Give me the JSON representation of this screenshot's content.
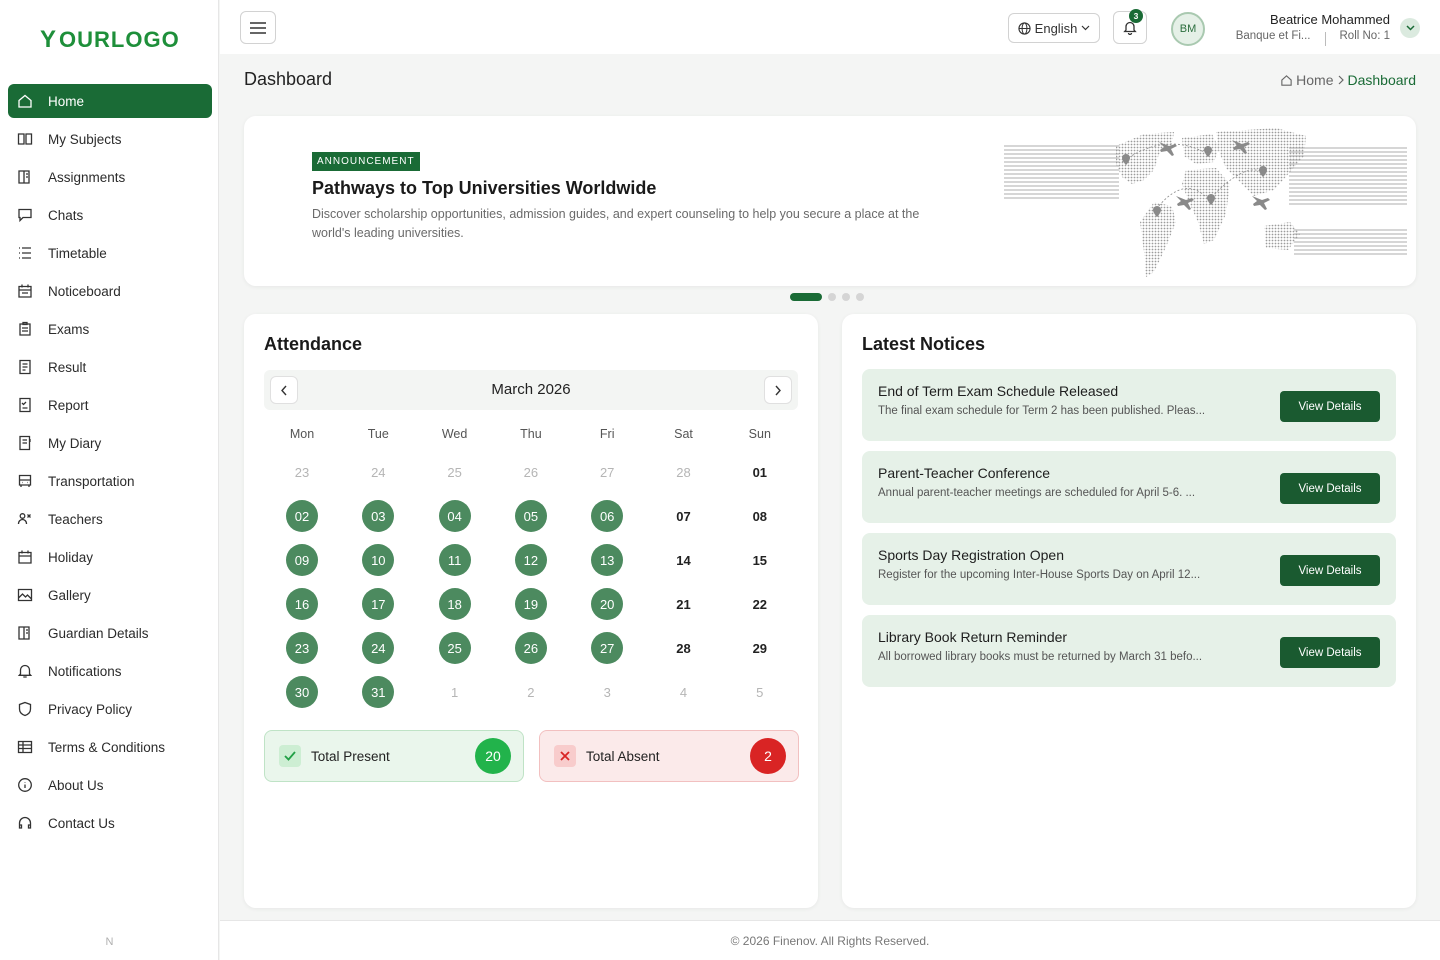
{
  "brand": {
    "logo_text": "OURLOGO",
    "logo_mark": "Y",
    "accent": "#1a6b36"
  },
  "sidebar": {
    "items": [
      {
        "label": "Home",
        "icon": "home-icon"
      },
      {
        "label": "My Subjects",
        "icon": "book-icon"
      },
      {
        "label": "Assignments",
        "icon": "assignment-icon"
      },
      {
        "label": "Chats",
        "icon": "chat-icon"
      },
      {
        "label": "Timetable",
        "icon": "list-icon"
      },
      {
        "label": "Noticeboard",
        "icon": "calendar-icon"
      },
      {
        "label": "Exams",
        "icon": "clipboard-icon"
      },
      {
        "label": "Result",
        "icon": "document-icon"
      },
      {
        "label": "Report",
        "icon": "report-icon"
      },
      {
        "label": "My Diary",
        "icon": "diary-icon"
      },
      {
        "label": "Transportation",
        "icon": "bus-icon"
      },
      {
        "label": "Teachers",
        "icon": "teachers-icon"
      },
      {
        "label": "Holiday",
        "icon": "holiday-icon"
      },
      {
        "label": "Gallery",
        "icon": "gallery-icon"
      },
      {
        "label": "Guardian Details",
        "icon": "guardian-icon"
      },
      {
        "label": "Notifications",
        "icon": "bell-icon"
      },
      {
        "label": "Privacy Policy",
        "icon": "shield-icon"
      },
      {
        "label": "Terms & Conditions",
        "icon": "table-icon"
      },
      {
        "label": "About Us",
        "icon": "info-icon"
      },
      {
        "label": "Contact Us",
        "icon": "headset-icon"
      }
    ],
    "footer_mark": "N"
  },
  "topbar": {
    "language": "English",
    "notification_count": "3",
    "avatar_initials": "BM",
    "user_name": "Beatrice Mohammed",
    "user_org": "Banque et Fi...",
    "user_roll": "Roll No: 1"
  },
  "header": {
    "title": "Dashboard",
    "breadcrumb_home": "Home",
    "breadcrumb_current": "Dashboard"
  },
  "banner": {
    "tag": "ANNOUNCEMENT",
    "title": "Pathways to Top Universities Worldwide",
    "description": "Discover scholarship opportunities, admission guides, and expert counseling to help you secure a place at the world's leading universities.",
    "slide_count": 4,
    "active_slide": 1
  },
  "attendance": {
    "title": "Attendance",
    "month": "March 2026",
    "weekdays": [
      "Mon",
      "Tue",
      "Wed",
      "Thu",
      "Fri",
      "Sat",
      "Sun"
    ],
    "weeks": [
      [
        {
          "d": "23",
          "s": "other"
        },
        {
          "d": "24",
          "s": "other"
        },
        {
          "d": "25",
          "s": "other"
        },
        {
          "d": "26",
          "s": "other"
        },
        {
          "d": "27",
          "s": "other"
        },
        {
          "d": "28",
          "s": "other"
        },
        {
          "d": "01",
          "s": "plain"
        }
      ],
      [
        {
          "d": "02",
          "s": "present"
        },
        {
          "d": "03",
          "s": "present"
        },
        {
          "d": "04",
          "s": "present"
        },
        {
          "d": "05",
          "s": "present"
        },
        {
          "d": "06",
          "s": "present"
        },
        {
          "d": "07",
          "s": "plain"
        },
        {
          "d": "08",
          "s": "plain"
        }
      ],
      [
        {
          "d": "09",
          "s": "present"
        },
        {
          "d": "10",
          "s": "present"
        },
        {
          "d": "11",
          "s": "present"
        },
        {
          "d": "12",
          "s": "present"
        },
        {
          "d": "13",
          "s": "present"
        },
        {
          "d": "14",
          "s": "plain"
        },
        {
          "d": "15",
          "s": "plain"
        }
      ],
      [
        {
          "d": "16",
          "s": "present"
        },
        {
          "d": "17",
          "s": "present"
        },
        {
          "d": "18",
          "s": "present"
        },
        {
          "d": "19",
          "s": "present"
        },
        {
          "d": "20",
          "s": "present"
        },
        {
          "d": "21",
          "s": "plain"
        },
        {
          "d": "22",
          "s": "plain"
        }
      ],
      [
        {
          "d": "23",
          "s": "present"
        },
        {
          "d": "24",
          "s": "present"
        },
        {
          "d": "25",
          "s": "present"
        },
        {
          "d": "26",
          "s": "present"
        },
        {
          "d": "27",
          "s": "present"
        },
        {
          "d": "28",
          "s": "plain"
        },
        {
          "d": "29",
          "s": "plain"
        }
      ],
      [
        {
          "d": "30",
          "s": "present"
        },
        {
          "d": "31",
          "s": "present"
        },
        {
          "d": "1",
          "s": "other"
        },
        {
          "d": "2",
          "s": "other"
        },
        {
          "d": "3",
          "s": "other"
        },
        {
          "d": "4",
          "s": "other"
        },
        {
          "d": "5",
          "s": "other"
        }
      ]
    ],
    "present_label": "Total Present",
    "present_count": "20",
    "absent_label": "Total Absent",
    "absent_count": "2"
  },
  "notices": {
    "title": "Latest Notices",
    "button_label": "View Details",
    "items": [
      {
        "title": "End of Term Exam Schedule Released",
        "desc": "The final exam schedule for Term 2 has been published. Pleas..."
      },
      {
        "title": "Parent-Teacher Conference",
        "desc": "Annual parent-teacher meetings are scheduled for April 5-6. ..."
      },
      {
        "title": "Sports Day Registration Open",
        "desc": "Register for the upcoming Inter-House Sports Day on April 12..."
      },
      {
        "title": "Library Book Return Reminder",
        "desc": "All borrowed library books must be returned by March 31 befo..."
      }
    ]
  },
  "footer": {
    "text": "© 2026 Finenov. All Rights Reserved."
  }
}
